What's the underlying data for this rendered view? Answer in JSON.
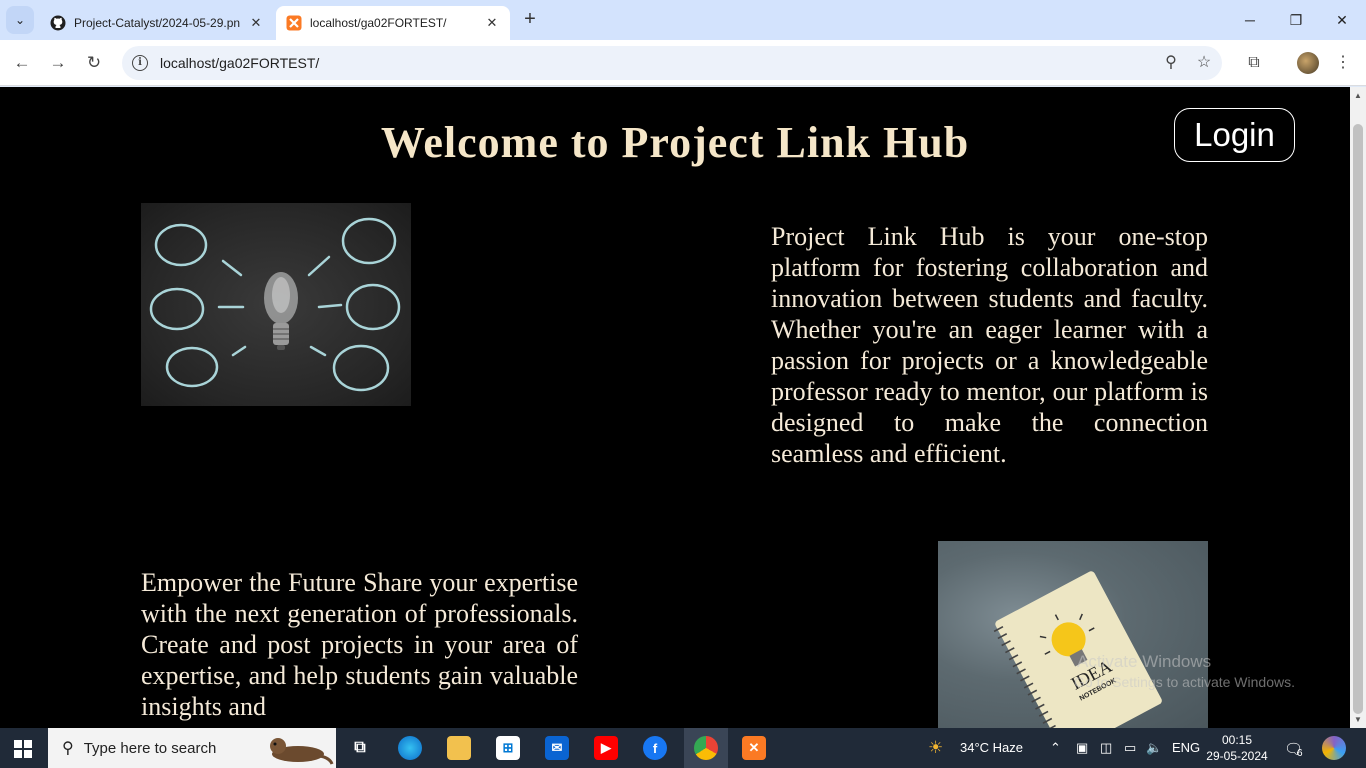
{
  "browser": {
    "tabs": [
      {
        "title": "Project-Catalyst/2024-05-29.pn",
        "icon": "github-icon",
        "active": false
      },
      {
        "title": "localhost/ga02FORTEST/",
        "icon": "xampp-icon",
        "active": true
      }
    ],
    "url": "localhost/ga02FORTEST/"
  },
  "page": {
    "title": "Welcome to Project Link Hub",
    "login_label": "Login",
    "intro_text": "Project Link Hub is your one-stop platform for fostering collaboration and innovation between students and faculty. Whether you're an eager learner with a passion for projects or a knowledgeable professor ready to mentor, our platform is designed to make the connection seamless and efficient.",
    "faculty_text": "Empower the Future Share your expertise with the next generation of professionals. Create and post projects in your area of expertise, and help students gain valuable insights and",
    "notebook_label_1": "IDEA",
    "notebook_label_2": "NOTEBOOK"
  },
  "watermark": {
    "line1": "Activate Windows",
    "line2": "Go to Settings to activate Windows."
  },
  "taskbar": {
    "search_placeholder": "Type here to search",
    "weather": "34°C  Haze",
    "language": "ENG",
    "time": "00:15",
    "date": "29-05-2024",
    "notification_count": "6"
  },
  "colors": {
    "page_bg": "#000000",
    "title_color": "#f5e6c8",
    "text_color": "#f5ead8",
    "tabstrip": "#d3e3fd",
    "taskbar": "#202a38"
  }
}
